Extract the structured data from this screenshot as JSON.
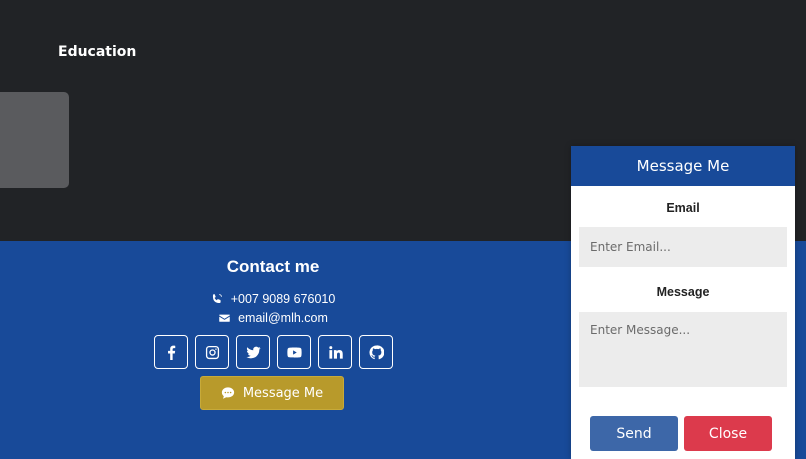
{
  "section": {
    "heading": "Education"
  },
  "contact": {
    "title": "Contact me",
    "phone": "+007 9089 676010",
    "email": "email@mlh.com",
    "socials": [
      {
        "icon": "facebook-icon"
      },
      {
        "icon": "instagram-icon"
      },
      {
        "icon": "twitter-icon"
      },
      {
        "icon": "youtube-icon"
      },
      {
        "icon": "linkedin-icon"
      },
      {
        "icon": "github-icon"
      }
    ],
    "message_button_label": "Message Me"
  },
  "message_panel": {
    "title": "Message Me",
    "email_label": "Email",
    "email_placeholder": "Enter Email...",
    "message_label": "Message",
    "message_placeholder": "Enter Message...",
    "send_label": "Send",
    "close_label": "Close"
  },
  "colors": {
    "dark_bg": "#212326",
    "brand_blue": "#184a99",
    "gold_button": "#b89a2b",
    "send_button": "#3d67a8",
    "close_button": "#dc3a4c"
  }
}
